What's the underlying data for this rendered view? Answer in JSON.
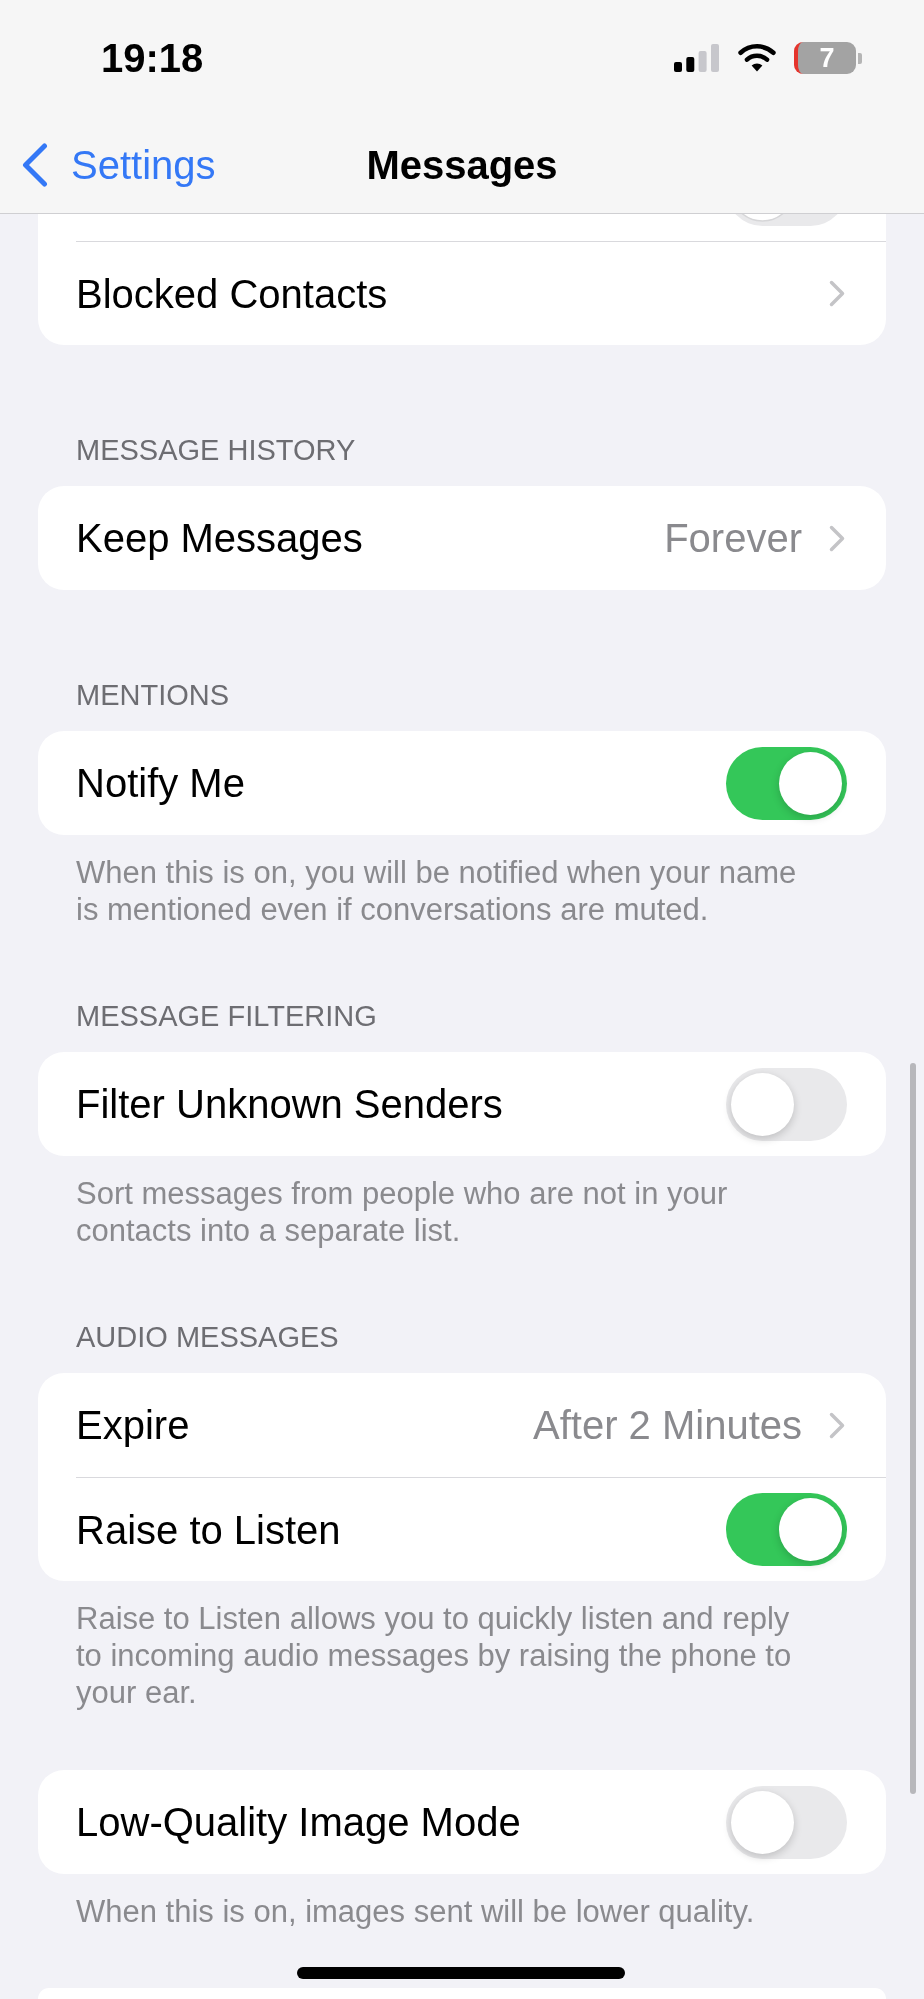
{
  "status_bar": {
    "time": "19:18",
    "battery": "7"
  },
  "nav": {
    "back_label": "Settings",
    "title": "Messages"
  },
  "sections": [
    {
      "rows": [
        {
          "kind": "toggle",
          "on": false
        },
        {
          "kind": "link",
          "label": "Blocked Contacts"
        }
      ]
    },
    {
      "header": "MESSAGE HISTORY",
      "rows": [
        {
          "kind": "link",
          "label": "Keep Messages",
          "value": "Forever"
        }
      ]
    },
    {
      "header": "MENTIONS",
      "rows": [
        {
          "kind": "toggle",
          "label": "Notify Me",
          "on": true
        }
      ],
      "footer": "When this is on, you will be notified when your name is mentioned even if conversations are muted."
    },
    {
      "header": "MESSAGE FILTERING",
      "rows": [
        {
          "kind": "toggle",
          "label": "Filter Unknown Senders",
          "on": false
        }
      ],
      "footer": "Sort messages from people who are not in your contacts into a separate list."
    },
    {
      "header": "AUDIO MESSAGES",
      "rows": [
        {
          "kind": "link",
          "label": "Expire",
          "value": "After 2 Minutes"
        },
        {
          "kind": "toggle",
          "label": "Raise to Listen",
          "on": true
        }
      ],
      "footer": "Raise to Listen allows you to quickly listen and reply to incoming audio messages by raising the phone to your ear."
    },
    {
      "rows": [
        {
          "kind": "toggle",
          "label": "Low-Quality Image Mode",
          "on": false
        }
      ],
      "footer": "When this is on, images sent will be lower quality."
    }
  ]
}
